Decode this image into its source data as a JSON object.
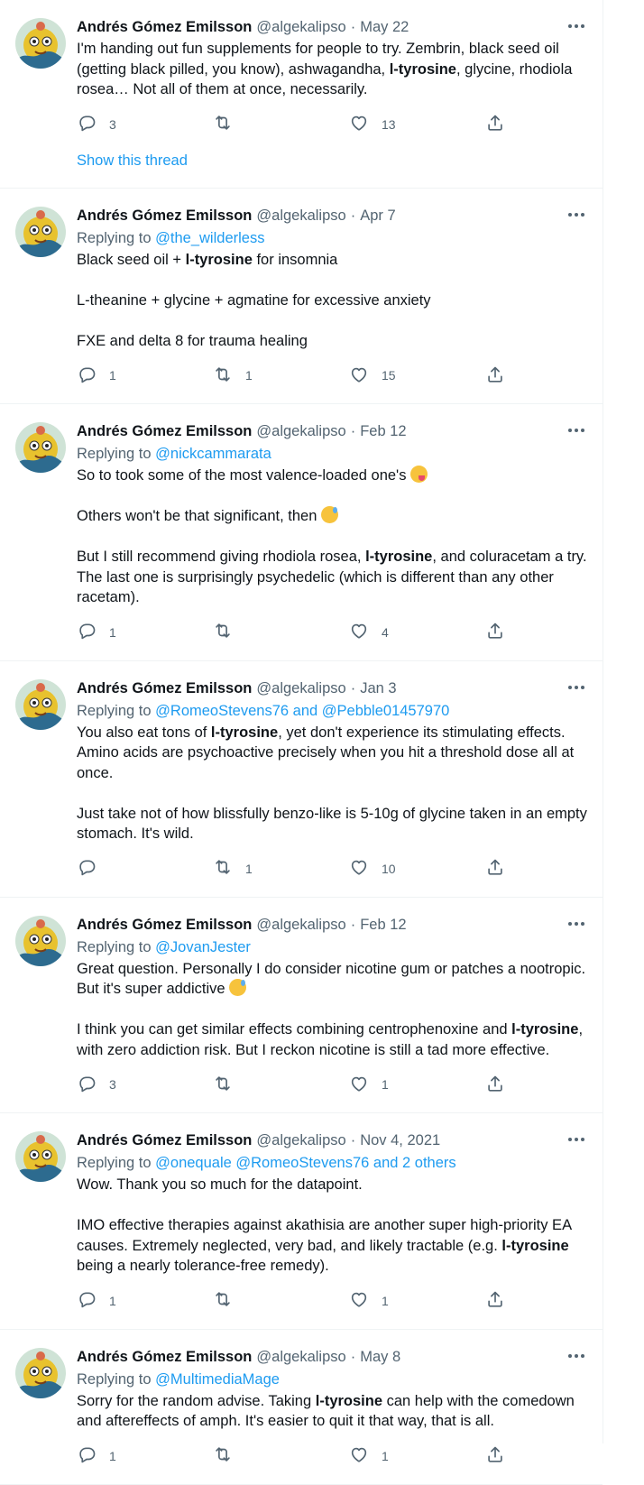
{
  "author": {
    "name": "Andrés Gómez Emilsson",
    "handle": "@algekalipso"
  },
  "replying_prefix": "Replying to",
  "show_thread": "Show this thread",
  "icons": {
    "reply": "reply-icon",
    "retweet": "retweet-icon",
    "like": "heart-icon",
    "share": "share-icon",
    "more": "more-icon"
  },
  "colors": {
    "accent": "#1d9bf0",
    "secondary": "#536471",
    "text": "#0f1419"
  },
  "tweets": [
    {
      "date": "May 22",
      "paragraphs": [
        [
          "I'm handing out fun supplements for people to try. Zembrin, black seed oil (getting black pilled, you know), ashwagandha, ",
          "l-tyrosine",
          ", glycine, rhodiola rosea… Not all of them at once, necessarily."
        ]
      ],
      "replies": "3",
      "retweets": "",
      "likes": "13"
    },
    {
      "date": "Apr 7",
      "replying_to": "@the_wilderless",
      "paragraphs": [
        [
          "Black seed oil + ",
          "l-tyrosine",
          " for insomnia"
        ],
        [
          "L-theanine + glycine + agmatine for excessive anxiety"
        ],
        [
          "FXE and delta 8 for trauma healing"
        ]
      ],
      "replies": "1",
      "retweets": "1",
      "likes": "15"
    },
    {
      "date": "Feb 12",
      "replying_to": "@nickcammarata",
      "paragraphs": [
        [
          "So to took some of the most valence-loaded one's "
        ],
        [
          "Others won't be that significant, then "
        ],
        [
          "But I still recommend giving rhodiola rosea, ",
          "l-tyrosine",
          ", and coluracetam a try. The last one is surprisingly psychedelic (which is different than any other racetam)."
        ]
      ],
      "replies": "1",
      "retweets": "",
      "likes": "4"
    },
    {
      "date": "Jan 3",
      "replying_to": "@RomeoStevens76 and @Pebble01457970",
      "paragraphs": [
        [
          "You also eat tons of ",
          "l-tyrosine",
          ", yet don't experience its stimulating effects. Amino acids are psychoactive precisely when you hit a threshold dose all at once."
        ],
        [
          "Just take not of how blissfully benzo-like is 5-10g of glycine taken in an empty stomach. It's wild."
        ]
      ],
      "replies": "",
      "retweets": "1",
      "likes": "10"
    },
    {
      "date": "Feb 12",
      "replying_to": "@JovanJester",
      "paragraphs": [
        [
          "Great question. Personally I do consider nicotine gum or patches a nootropic. But it's super addictive "
        ],
        [
          "I think you can get similar effects combining centrophenoxine and ",
          "l-tyrosine",
          ", with zero addiction risk. But I reckon nicotine is still a tad more effective."
        ]
      ],
      "replies": "3",
      "retweets": "",
      "likes": "1"
    },
    {
      "date": "Nov 4, 2021",
      "replying_to": "@onequale @RomeoStevens76 and 2 others",
      "paragraphs": [
        [
          "Wow. Thank you so much for the datapoint."
        ],
        [
          "IMO effective therapies against akathisia are another super high-priority EA causes. Extremely neglected, very bad, and likely tractable (e.g. ",
          "l-tyrosine",
          " being a nearly tolerance-free remedy)."
        ]
      ],
      "replies": "1",
      "retweets": "",
      "likes": "1"
    },
    {
      "date": "May 8",
      "replying_to": "@MultimediaMage",
      "paragraphs": [
        [
          "Sorry for the random advise. Taking ",
          "l-tyrosine",
          " can help with the comedown and aftereffects of amph. It's easier to quit it that way, that is all."
        ]
      ],
      "replies": "1",
      "retweets": "",
      "likes": "1"
    }
  ]
}
